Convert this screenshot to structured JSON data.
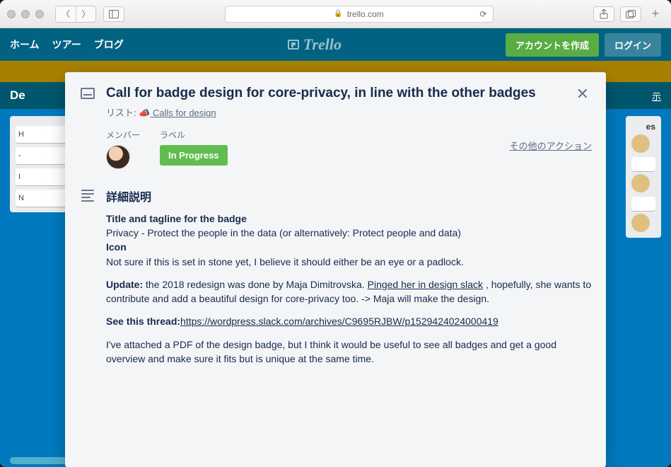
{
  "browser": {
    "url": "trello.com"
  },
  "header": {
    "nav": [
      "ホーム",
      "ツアー",
      "ブログ"
    ],
    "logo": "Trello",
    "signup": "アカウントを作成",
    "login": "ログイン"
  },
  "board": {
    "title_prefix": "De",
    "show_menu": "示"
  },
  "lists_left": {
    "items": [
      "H",
      "- ",
      "I",
      "N"
    ]
  },
  "lists_right": {
    "header": "es"
  },
  "card": {
    "title": "Call for badge design for core-privacy, in line with the other badges",
    "list_label_prefix": "リスト: ",
    "list_emoji": "📣",
    "list_name": " Calls for design",
    "members_label": "メンバー",
    "labels_label": "ラベル",
    "label_chip": "In Progress",
    "other_actions": "その他のアクション",
    "desc_header": "詳細説明",
    "desc": {
      "p1_b": "Title and tagline for the badge",
      "p1_line": "Privacy - Protect the people in the data (or alternatively: Protect people and data)",
      "p2_b": "Icon",
      "p2_line": "Not sure if this is set in stone yet, I believe it should either be an eye or a padlock.",
      "p3_b": "Update:",
      "p3_a": " the 2018 redesign was done by Maja Dimitrovska. ",
      "p3_link": "Pinged her in design slack",
      "p3_c": " , hopefully, she wants to contribute and add a beautiful design for core-privacy too. -> Maja will make the design.",
      "p4_b": "See this thread:",
      "p4_link": "https://wordpress.slack.com/archives/C9695RJBW/p1529424024000419",
      "p5": "I've attached a PDF of the design badge, but I think it would be useful to see all badges and get a good overview and make sure it fits but is unique at the same time."
    }
  }
}
